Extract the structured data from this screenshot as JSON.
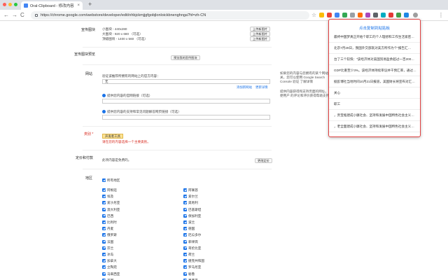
{
  "browser": {
    "tab_title": "Oral-Clipboard - 修改内容",
    "tab_close": "×",
    "new_tab": "+",
    "back": "←",
    "forward": "→",
    "reload": "C",
    "url": "https://chrome.google.com/webstore/developer/edit/nhbjckmjjgfgobjlonloickbnenghnga?hl=zh-CN",
    "star": "☆"
  },
  "form": {
    "promo_label": "宣传图块",
    "promo_small": "小图块 - 440x280",
    "promo_large": "大图块 - 920 x 680 （可选）",
    "promo_marquee": "顶级图块 - 1400 x 560 （可选）",
    "upload_btn": "上传新图片",
    "preview_label": "宣传图块预览",
    "preview_btn": "预览我的宣传图块",
    "website_label": "网站",
    "website_desc": "验证该推荐所拥有的网站上的官方内容：",
    "website_select": "无",
    "add_site_link": "添加新网站",
    "learn_more_link": "更新详情",
    "support_url_label": "提供您内容的官网链接（可选）",
    "support_ext_label": "提供您内容的支持和常见问题解答网页链接（可选）",
    "side_note_1": "如果您的内容与您拥有的某个网站 相关，您可以使用 Google Search Console 验证 了解详情",
    "side_note_2": "提供内容获得和支持页面的网址，以便用户 的评论和评价获得帮助支持。",
    "category_label": "类别",
    "category_tag": "开发者工具",
    "category_error": "请在您的内容选择一个主要类别。",
    "pricing_label": "定价和付款",
    "pricing_text": "此项内容是免费的。",
    "pricing_btn": "更改定价",
    "region_label": "地区",
    "all_regions": "所有地区",
    "regions_left": [
      "阿根廷",
      "埃及",
      "爱沙尼亚",
      "澳大利亚",
      "巴西",
      "比利时",
      "丹麦",
      "俄罗斯",
      "法国",
      "芬兰",
      "冰岛",
      "加拿大",
      "立陶宛",
      "马来西亚",
      "美国"
    ],
    "regions_right": [
      "阿联酋",
      "爱尔兰",
      "奥地利",
      "巴基斯坦",
      "保加利亚",
      "波兰",
      "德国",
      "厄瓜多尔",
      "菲律宾",
      "哥伦比亚",
      "荷兰",
      "捷克共和国",
      "罗马尼亚",
      "秘鲁",
      "墨西哥"
    ]
  },
  "popup": {
    "title": "点击复制到粘贴板",
    "rows": [
      "最终中国梦真正开始个职工的个人理想和工作生活紧密…",
      "北京7月29日，我国外交部就对美方所作为个“报告汇…",
      "台了三个较快：“该经济体对美国贸易盈余超过一百200…",
      "GDP比重至少3%。该经济体持续审议并干预汇率，通过汇…",
      "据彭博社当地时间10月21日报道，美国财长将宣布对汇…",
      "关心",
      "职工",
      "，贵宝瓶建成小康社会、坚持和发展中国特色社会主义…",
      "，老全面建成小康社会、坚持和发展中国特色社会主义…"
    ]
  },
  "colors": {
    "accent": "#1a73e8",
    "popup_border": "#e04040",
    "error": "#d93025",
    "tag_bg": "#fde293"
  }
}
